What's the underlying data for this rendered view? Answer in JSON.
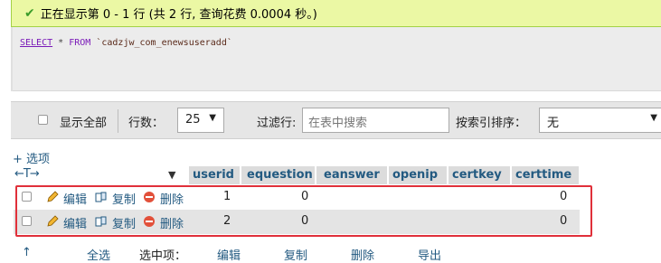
{
  "message": {
    "text": "正在显示第 0 - 1 行 (共 2 行, 查询花费 0.0004 秒。)"
  },
  "sql": {
    "select": "SELECT",
    "star": "*",
    "from": "FROM",
    "table": "`cadzjw_com_enewsuseradd`"
  },
  "nav": {
    "show_all": "显示全部",
    "rows_label": "行数：",
    "rows_value": "25",
    "filter_label": "过滤行:",
    "filter_placeholder": "在表中搜索",
    "sort_label": "按索引排序：",
    "sort_value": "无"
  },
  "options_link": "+ 选项",
  "columns": [
    "userid",
    "equestion",
    "eanswer",
    "openip",
    "certkey",
    "certtime"
  ],
  "actions": {
    "edit": "编辑",
    "copy": "复制",
    "delete": "删除"
  },
  "rows": [
    {
      "userid": "1",
      "equestion": "0",
      "certtime": "0"
    },
    {
      "userid": "2",
      "equestion": "0",
      "certtime": "0"
    }
  ],
  "footer": {
    "check_all": "全选",
    "with_selected": "选中项：",
    "edit": "编辑",
    "copy": "复制",
    "delete": "删除",
    "export": "导出"
  },
  "colors": {
    "success_bg": "#ebf8a4",
    "link": "#235a81",
    "highlight": "#e0303a"
  }
}
